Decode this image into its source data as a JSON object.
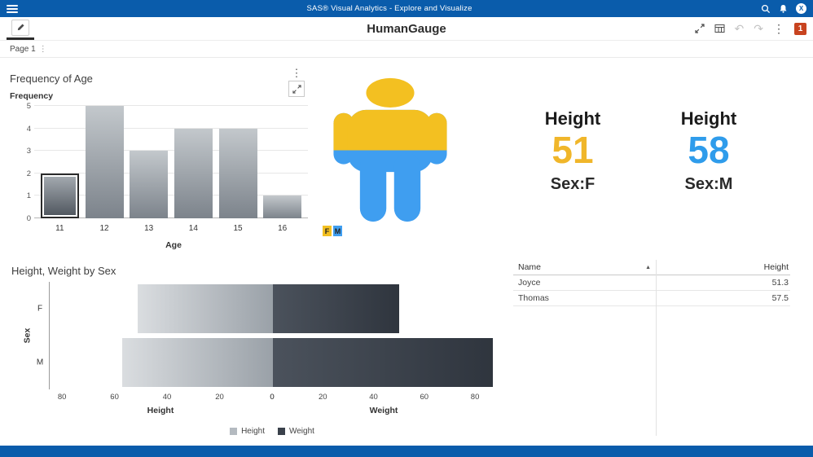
{
  "colors": {
    "brand_blue": "#0a5cab",
    "badge_orange": "#c8431f"
  },
  "app_bar": {
    "title": "SAS® Visual Analytics - Explore and Visualize",
    "avatar_letter": "X"
  },
  "toolbar": {
    "title": "HumanGauge",
    "undo_icon": "↶",
    "redo_icon": "↷",
    "kebab_icon": "⋮",
    "badge_count": "1"
  },
  "tab_bar": {
    "page_label": "Page 1",
    "kebab_icon": "⋮"
  },
  "freq_chart": {
    "title": "Frequency of Age",
    "kebab_icon": "⋮",
    "chart_data": {
      "type": "bar",
      "title": "Frequency of Age",
      "xlabel": "Age",
      "ylabel": "Frequency",
      "categories": [
        "11",
        "12",
        "13",
        "14",
        "15",
        "16"
      ],
      "values": [
        2,
        5,
        3,
        4,
        4,
        1
      ],
      "ylim": [
        0,
        5
      ],
      "yticks": [
        0,
        1,
        2,
        3,
        4,
        5
      ],
      "selected_index": 0
    }
  },
  "human_gauge": {
    "female_color": "#f3c021",
    "male_color": "#3f9ef0",
    "legend": [
      {
        "label": "F",
        "color": "#f3c021"
      },
      {
        "label": "M",
        "color": "#3f9ef0"
      }
    ]
  },
  "kpis": [
    {
      "title": "Height",
      "value": "51",
      "value_color": "#f0b62a",
      "subtitle": "Sex:F"
    },
    {
      "title": "Height",
      "value": "58",
      "value_color": "#2f9ceb",
      "subtitle": "Sex:M"
    }
  ],
  "butterfly_chart": {
    "title": "Height, Weight by Sex",
    "chart_data": {
      "type": "bar",
      "orientation": "horizontal-diverging",
      "categories": [
        "F",
        "M"
      ],
      "series": [
        {
          "name": "Height",
          "values": [
            51.3,
            57.5
          ],
          "axis_max": 85,
          "ticks": [
            80,
            60,
            40,
            20,
            0
          ]
        },
        {
          "name": "Weight",
          "values": [
            50,
            87
          ],
          "axis_max": 88,
          "ticks": [
            0,
            20,
            40,
            60,
            80
          ]
        }
      ],
      "ylabel": "Sex",
      "xlabel_left": "Height",
      "xlabel_right": "Weight",
      "legend_position": "bottom"
    },
    "legend": [
      {
        "label": "Height",
        "color": "#b4bac0"
      },
      {
        "label": "Weight",
        "color": "#3a414b"
      }
    ]
  },
  "table": {
    "columns": [
      {
        "label": "Name",
        "sort": "▲"
      },
      {
        "label": "Height"
      }
    ],
    "rows": [
      [
        "Joyce",
        "51.3"
      ],
      [
        "Thomas",
        "57.5"
      ]
    ]
  }
}
